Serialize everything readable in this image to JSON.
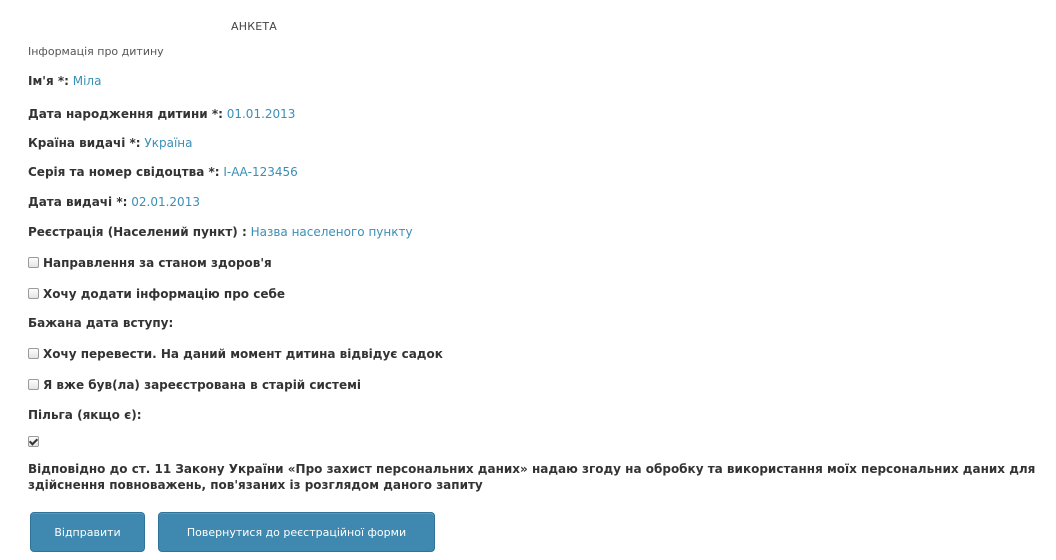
{
  "form": {
    "title": "АНКЕТА",
    "section": "Інформація про дитину",
    "fields": [
      {
        "label": "Ім'я *:",
        "value": "Міла"
      },
      {
        "label": "Дата народження дитини *:",
        "value": "01.01.2013"
      },
      {
        "label": "Країна видачі *:",
        "value": "Україна"
      },
      {
        "label": "Серія та номер свідоцтва *:",
        "value": "І-АА-123456"
      },
      {
        "label": "Дата видачі *:",
        "value": "02.01.2013"
      },
      {
        "label": "Реєстрація (Населений пункт) :",
        "value": "Назва населеного пункту"
      }
    ],
    "health_referral": {
      "label": "Направлення за станом здоров'я",
      "checked": false
    },
    "add_self_info": {
      "label": "Хочу додати інформацію про себе",
      "checked": false
    },
    "desired_date_label": "Бажана дата вступу:",
    "transfer": {
      "label": "Хочу перевести. На даний момент дитина відвідує садок",
      "checked": false
    },
    "old_system": {
      "label": "Я вже був(ла) зареєстрована в старій системі",
      "checked": false
    },
    "benefit_label": "Пільга (якщо є):",
    "consent": {
      "text": "Відповідно до ст. 11 Закону України «Про захист персональних даних» надаю згоду на обробку та використання моїх персональних даних для здійснення повноважень, пов'язаних із розглядом даного запиту",
      "checked": true
    },
    "buttons": {
      "submit": "Відправити",
      "back": "Повернутися до реєстраційної форми"
    }
  },
  "colors": {
    "value_link": "#3a8fb7",
    "button_bg": "#3f88b0",
    "button_text": "#ffffff"
  }
}
